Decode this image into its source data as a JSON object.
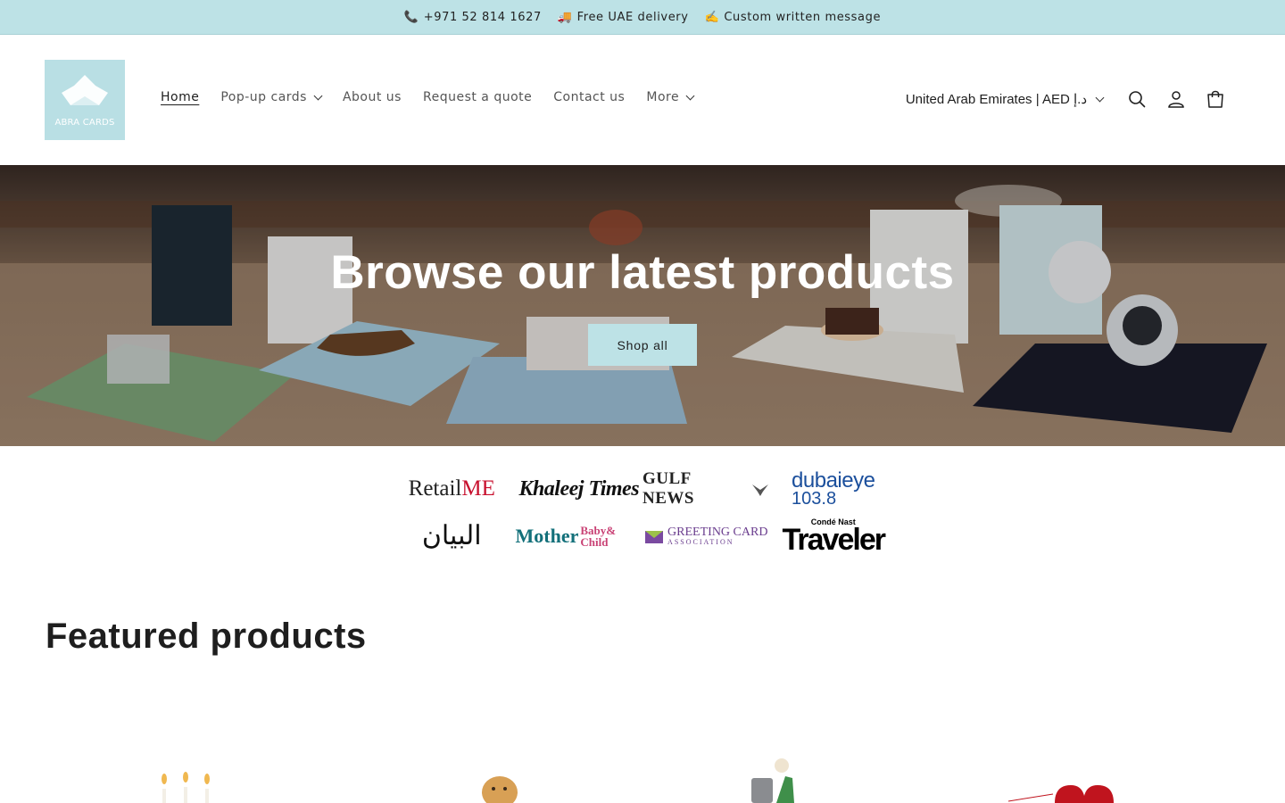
{
  "announcement": {
    "phone_icon": "phone-emoji",
    "phone": "+971 52 814 1627",
    "delivery_icon": "truck-emoji",
    "delivery": "Free UAE delivery",
    "message_icon": "writing-hand-emoji",
    "message": "Custom written message"
  },
  "brand": {
    "logo_text": "ABRA CARDS",
    "logo_color": "#b9dfe4"
  },
  "nav": {
    "items": [
      {
        "label": "Home",
        "active": true,
        "dropdown": false
      },
      {
        "label": "Pop-up cards",
        "active": false,
        "dropdown": true
      },
      {
        "label": "About us",
        "active": false,
        "dropdown": false
      },
      {
        "label": "Request a quote",
        "active": false,
        "dropdown": false
      },
      {
        "label": "Contact us",
        "active": false,
        "dropdown": false
      },
      {
        "label": "More",
        "active": false,
        "dropdown": true
      }
    ]
  },
  "header_tools": {
    "locale": "United Arab Emirates | AED د.إ",
    "icons": [
      "search-icon",
      "account-icon",
      "cart-icon"
    ]
  },
  "hero": {
    "title": "Browse our latest products",
    "button": "Shop all"
  },
  "press": {
    "logos": [
      {
        "name": "Retail ME",
        "a": "Retail",
        "b": "ME"
      },
      {
        "name": "Khaleej Times",
        "text": "Khaleej Times"
      },
      {
        "name": "Gulf News",
        "text": "GULF NEWS"
      },
      {
        "name": "Dubai Eye 103.8",
        "a": "dubaieye",
        "b": "103.8"
      },
      {
        "name": "Al Bayan",
        "text": "البيان"
      },
      {
        "name": "Mother Baby & Child",
        "a": "Mother",
        "b": "Baby& Child"
      },
      {
        "name": "Greeting Card Association",
        "a": "GREETING CARD",
        "b": "ASSOCIATION"
      },
      {
        "name": "Condé Nast Traveler",
        "a": "Condé Nast",
        "b": "Traveler"
      }
    ]
  },
  "featured": {
    "title": "Featured products"
  },
  "colors": {
    "accent": "#bde2e6",
    "text": "#1e1e1e"
  }
}
